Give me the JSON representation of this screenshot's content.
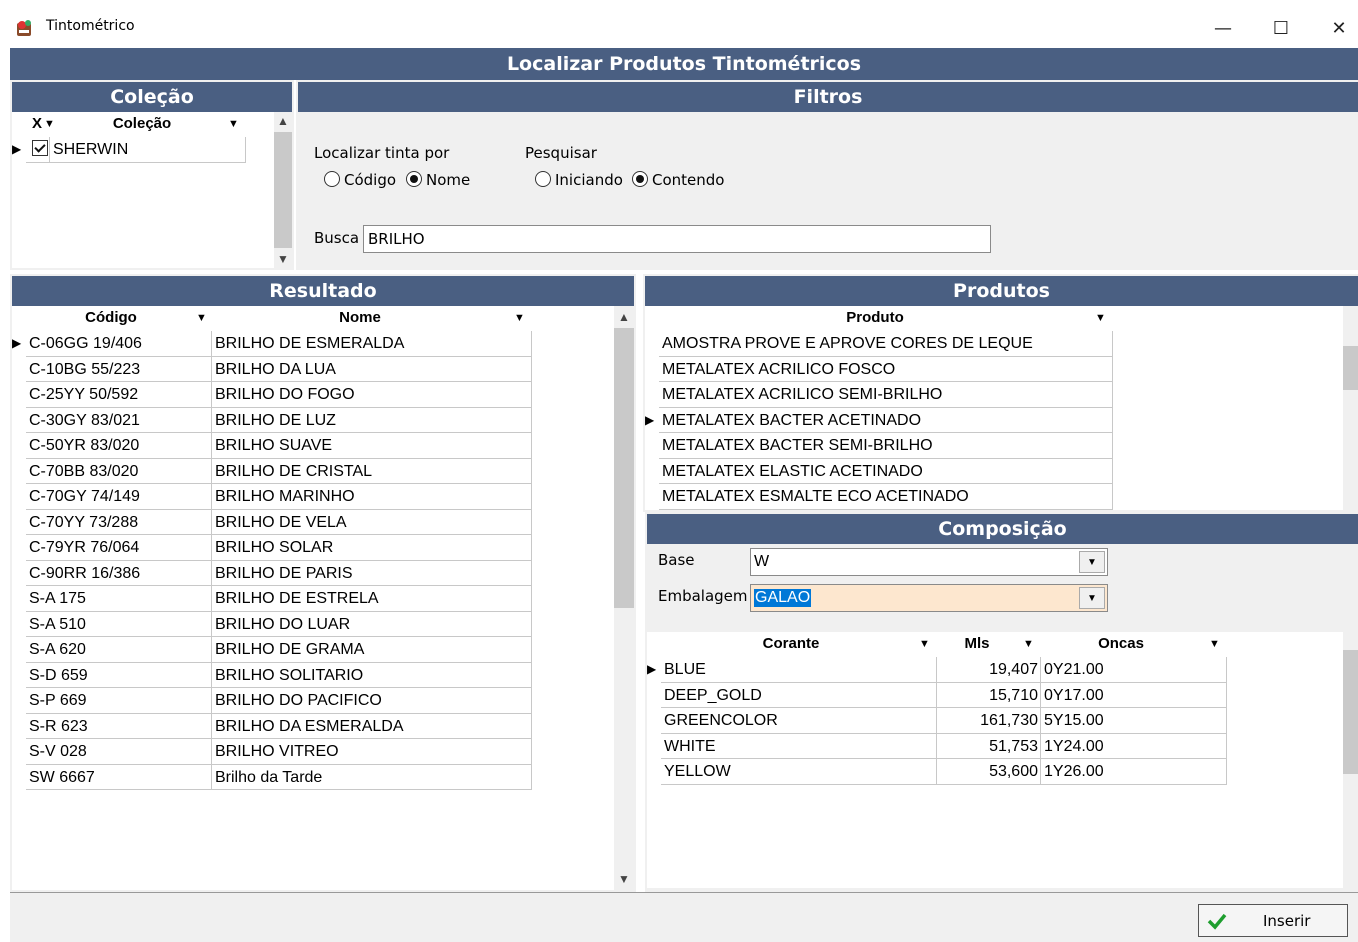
{
  "window": {
    "title": "Tintométrico",
    "minimize": "—",
    "maximize": "☐",
    "close": "✕"
  },
  "main_header": "Localizar Produtos Tintométricos",
  "colecao": {
    "header": "Coleção",
    "col_x": "X",
    "col_colecao": "Coleção",
    "rows": [
      {
        "checked": true,
        "name": "SHERWIN"
      }
    ]
  },
  "filtros": {
    "header": "Filtros",
    "localizar_label": "Localizar tinta por",
    "opt_codigo": "Código",
    "opt_nome": "Nome",
    "pesquisar_label": "Pesquisar",
    "opt_iniciando": "Iniciando",
    "opt_contendo": "Contendo",
    "busca_label": "Busca",
    "busca_value": "BRILHO"
  },
  "resultado": {
    "header": "Resultado",
    "col_codigo": "Código",
    "col_nome": "Nome",
    "rows": [
      {
        "codigo": "C-06GG 19/406",
        "nome": "BRILHO DE ESMERALDA"
      },
      {
        "codigo": "C-10BG 55/223",
        "nome": "BRILHO DA LUA"
      },
      {
        "codigo": "C-25YY 50/592",
        "nome": "BRILHO DO FOGO"
      },
      {
        "codigo": "C-30GY 83/021",
        "nome": "BRILHO DE LUZ"
      },
      {
        "codigo": "C-50YR 83/020",
        "nome": "BRILHO SUAVE"
      },
      {
        "codigo": "C-70BB 83/020",
        "nome": "BRILHO DE CRISTAL"
      },
      {
        "codigo": "C-70GY 74/149",
        "nome": "BRILHO MARINHO"
      },
      {
        "codigo": "C-70YY 73/288",
        "nome": "BRILHO DE VELA"
      },
      {
        "codigo": "C-79YR 76/064",
        "nome": "BRILHO SOLAR"
      },
      {
        "codigo": "C-90RR 16/386",
        "nome": "BRILHO DE PARIS"
      },
      {
        "codigo": "S-A 175",
        "nome": "BRILHO DE ESTRELA"
      },
      {
        "codigo": "S-A 510",
        "nome": "BRILHO DO LUAR"
      },
      {
        "codigo": "S-A 620",
        "nome": "BRILHO DE GRAMA"
      },
      {
        "codigo": "S-D 659",
        "nome": "BRILHO SOLITARIO"
      },
      {
        "codigo": "S-P 669",
        "nome": "BRILHO DO PACIFICO"
      },
      {
        "codigo": "S-R 623",
        "nome": "BRILHO DA ESMERALDA"
      },
      {
        "codigo": "S-V 028",
        "nome": "BRILHO VITREO"
      },
      {
        "codigo": "SW 6667",
        "nome": "Brilho da Tarde"
      }
    ]
  },
  "produtos": {
    "header": "Produtos",
    "col_produto": "Produto",
    "rows": [
      "AMOSTRA PROVE E APROVE CORES DE LEQUE",
      "METALATEX ACRILICO FOSCO",
      "METALATEX ACRILICO SEMI-BRILHO",
      "METALATEX BACTER ACETINADO",
      "METALATEX BACTER SEMI-BRILHO",
      "METALATEX ELASTIC ACETINADO",
      "METALATEX ESMALTE ECO ACETINADO"
    ]
  },
  "composicao": {
    "header": "Composição",
    "base_label": "Base",
    "base_value": "W",
    "embalagem_label": "Embalagem",
    "embalagem_value": "GALAO",
    "col_corante": "Corante",
    "col_mls": "Mls",
    "col_oncas": "Oncas",
    "rows": [
      {
        "corante": "BLUE",
        "mls": "19,407",
        "oncas": "0Y21.00"
      },
      {
        "corante": "DEEP_GOLD",
        "mls": "15,710",
        "oncas": "0Y17.00"
      },
      {
        "corante": "GREENCOLOR",
        "mls": "161,730",
        "oncas": "5Y15.00"
      },
      {
        "corante": "WHITE",
        "mls": "51,753",
        "oncas": "1Y24.00"
      },
      {
        "corante": "YELLOW",
        "mls": "53,600",
        "oncas": "1Y26.00"
      }
    ]
  },
  "footer": {
    "inserir_label": "Inserir"
  },
  "colors": {
    "header_bg": "#4a5f82",
    "embalagem_bg": "#fde7cf",
    "selected_bg": "#0078d7",
    "check_green": "#1e9e2e"
  }
}
